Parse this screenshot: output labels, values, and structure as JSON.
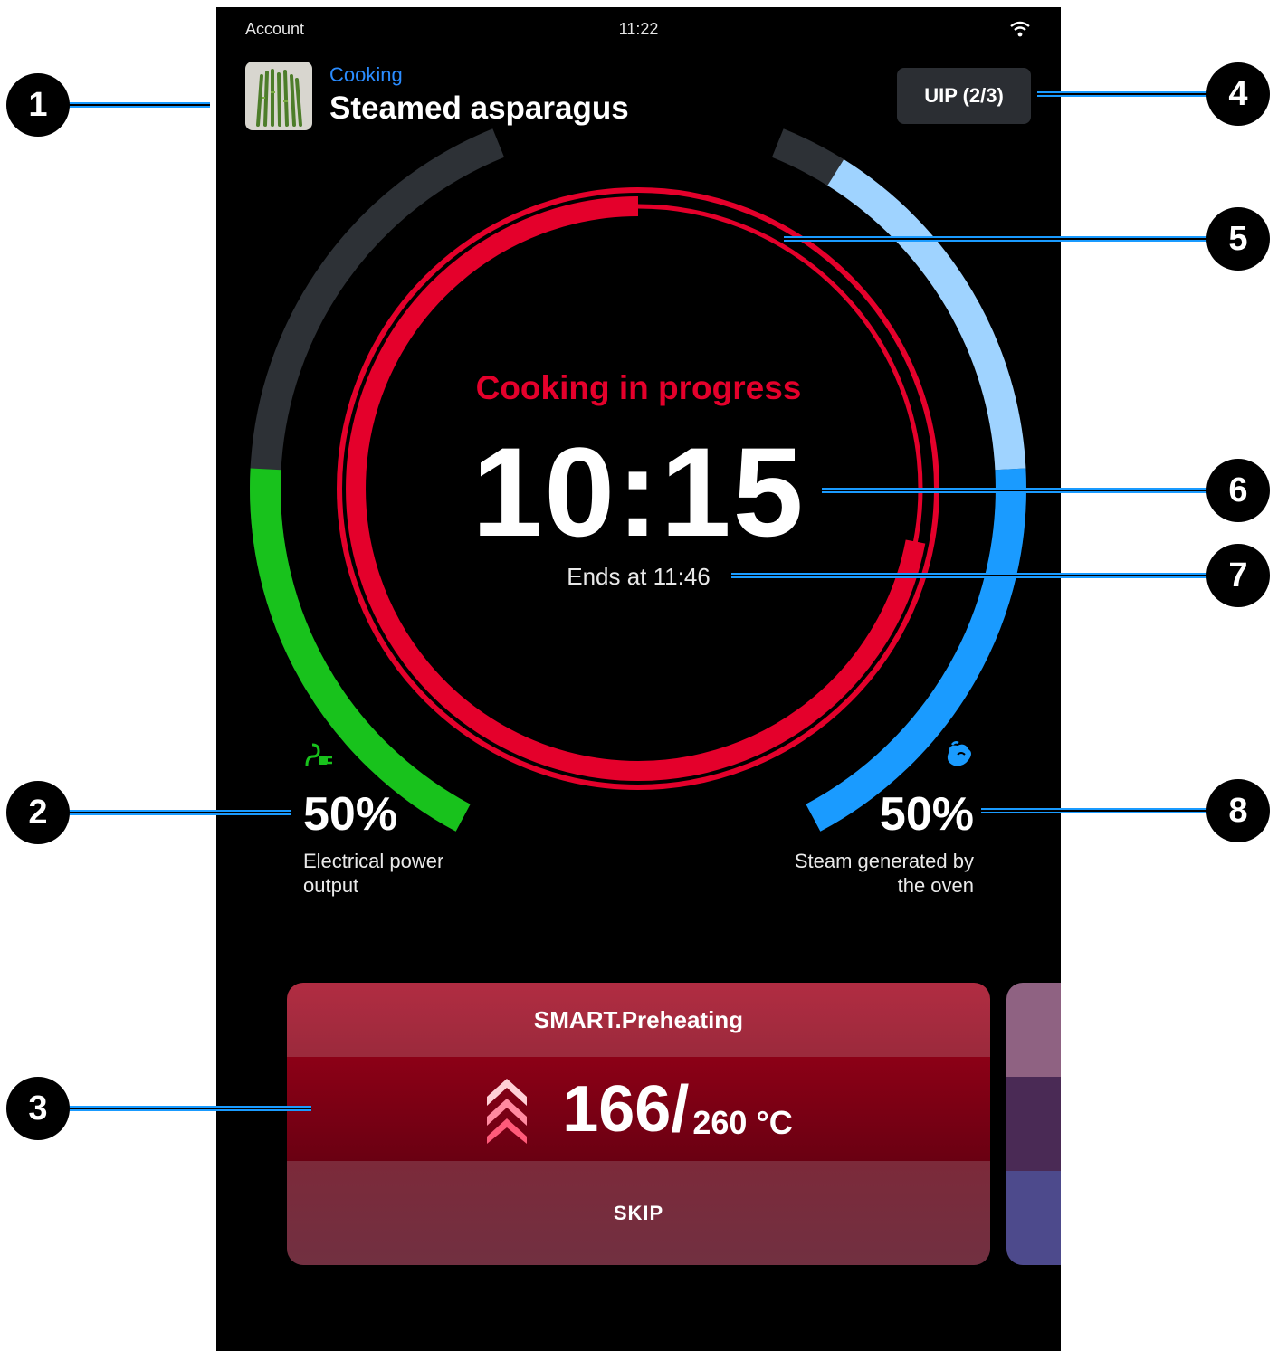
{
  "status_bar": {
    "account": "Account",
    "time": "11:22"
  },
  "header": {
    "category": "Cooking",
    "recipe_name": "Steamed asparagus",
    "uip_button": "UIP (2/3)"
  },
  "timer": {
    "status": "Cooking in progress",
    "remaining": "10:15",
    "ends_at": "Ends at 11:46",
    "progress_fraction": 0.72
  },
  "metrics": {
    "power": {
      "value": "50%",
      "label_line1": "Electrical power",
      "label_line2": "output",
      "icon": "plug-icon",
      "level": 0.5
    },
    "steam": {
      "value": "50%",
      "label_line1": "Steam generated by",
      "label_line2": "the oven",
      "icon": "steam-icon",
      "level": 0.5
    }
  },
  "phase_card": {
    "title": "SMART.Preheating",
    "current_temp": "166/",
    "target_temp": "260 °C",
    "action": "SKIP"
  },
  "callouts": [
    "1",
    "2",
    "3",
    "4",
    "5",
    "6",
    "7",
    "8"
  ],
  "colors": {
    "accent_red": "#e4002b",
    "power_green": "#18c21c",
    "steam_blue": "#1a9bff",
    "steam_light_blue": "#9fd3ff",
    "track_gray": "#2d3136"
  }
}
